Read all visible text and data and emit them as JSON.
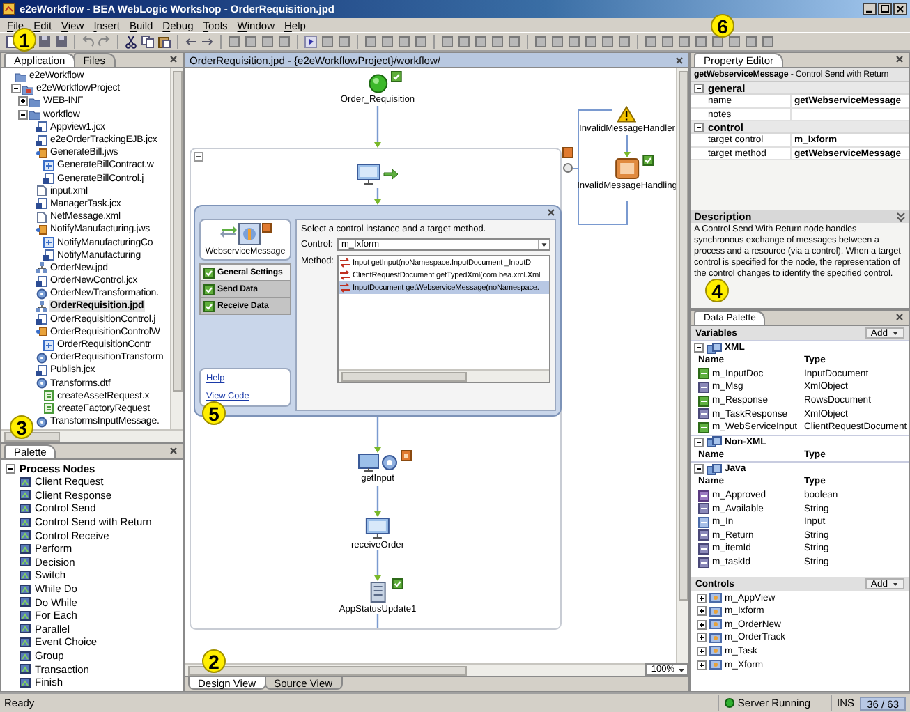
{
  "window": {
    "title": "e2eWorkflow - BEA WebLogic Workshop - OrderRequisition.jpd"
  },
  "menu": [
    "File",
    "Edit",
    "View",
    "Insert",
    "Build",
    "Debug",
    "Tools",
    "Window",
    "Help"
  ],
  "application_panel": {
    "tabs": [
      {
        "label": "Application",
        "selected": true
      },
      {
        "label": "Files",
        "selected": false
      }
    ],
    "tree": [
      {
        "label": "e2eWorkflow",
        "kind": "app",
        "selected": false,
        "children": [
          {
            "label": "e2eWorkflowProject",
            "kind": "project",
            "expanded": true,
            "selected": false,
            "children": [
              {
                "label": "WEB-INF",
                "kind": "folder",
                "expanded": false,
                "selected": false
              },
              {
                "label": "workflow",
                "kind": "folder",
                "expanded": true,
                "selected": false,
                "children": [
                  {
                    "label": "Appview1.jcx",
                    "kind": "control",
                    "selected": false
                  },
                  {
                    "label": "e2eOrderTrackingEJB.jcx",
                    "kind": "control",
                    "selected": false
                  },
                  {
                    "label": "GenerateBill.jws",
                    "kind": "service",
                    "selected": false,
                    "children": [
                      {
                        "label": "GenerateBillContract.w",
                        "kind": "wsdl",
                        "selected": false
                      },
                      {
                        "label": "GenerateBillControl.j",
                        "kind": "control",
                        "selected": false
                      }
                    ]
                  },
                  {
                    "label": "input.xml",
                    "kind": "xml",
                    "selected": false
                  },
                  {
                    "label": "ManagerTask.jcx",
                    "kind": "control",
                    "selected": false
                  },
                  {
                    "label": "NetMessage.xml",
                    "kind": "xml",
                    "selected": false
                  },
                  {
                    "label": "NotifyManufacturing.jws",
                    "kind": "service",
                    "selected": false,
                    "children": [
                      {
                        "label": "NotifyManufacturingCo",
                        "kind": "wsdl",
                        "selected": false
                      },
                      {
                        "label": "NotifyManufacturing",
                        "kind": "control",
                        "selected": false
                      }
                    ]
                  },
                  {
                    "label": "OrderNew.jpd",
                    "kind": "process",
                    "selected": false
                  },
                  {
                    "label": "OrderNewControl.jcx",
                    "kind": "control",
                    "selected": false
                  },
                  {
                    "label": "OrderNewTransformation.",
                    "kind": "transform",
                    "selected": false
                  },
                  {
                    "label": "OrderRequisition.jpd",
                    "kind": "process",
                    "selected": true
                  },
                  {
                    "label": "OrderRequisitionControl.j",
                    "kind": "control",
                    "selected": false
                  },
                  {
                    "label": "OrderRequisitionControlW",
                    "kind": "service",
                    "selected": false,
                    "children": [
                      {
                        "label": "OrderRequisitionContr",
                        "kind": "wsdl",
                        "selected": false
                      }
                    ]
                  },
                  {
                    "label": "OrderRequisitionTransform",
                    "kind": "transform",
                    "selected": false
                  },
                  {
                    "label": "Publish.jcx",
                    "kind": "control",
                    "selected": false
                  },
                  {
                    "label": "Transforms.dtf",
                    "kind": "transform",
                    "selected": false,
                    "children": [
                      {
                        "label": "createAssetRequest.x",
                        "kind": "query",
                        "selected": false
                      },
                      {
                        "label": "createFactoryRequest",
                        "kind": "query",
                        "selected": false
                      }
                    ]
                  },
                  {
                    "label": "TransformsInputMessage.",
                    "kind": "transform",
                    "selected": false
                  }
                ]
              }
            ]
          }
        ]
      }
    ]
  },
  "palette_panel": {
    "tab": "Palette",
    "section": "Process Nodes",
    "expanded": true,
    "items": [
      "Client Request",
      "Client Response",
      "Control Send",
      "Control Send with Return",
      "Control Receive",
      "Perform",
      "Decision",
      "Switch",
      "While Do",
      "Do While",
      "For Each",
      "Parallel",
      "Event Choice",
      "Group",
      "Transaction",
      "Finish"
    ]
  },
  "editor": {
    "tab": "OrderRequisition.jpd - {e2eWorkflowProject}/workflow/",
    "nodes": [
      {
        "kind": "start",
        "label": "Order_Requisition"
      },
      {
        "kind": "client"
      },
      {
        "kind": "control_send",
        "label": "getInput"
      },
      {
        "kind": "client_receive",
        "label": "receiveOrder"
      },
      {
        "kind": "control_receive",
        "label": "AppStatusUpdate1"
      },
      {
        "kind": "warning",
        "label": "InvalidMessageHandler"
      },
      {
        "kind": "perform",
        "label": "InvalidMessageHandling"
      }
    ],
    "dialog": {
      "node_label": "WebserviceMessage",
      "tabs": [
        {
          "label": "General Settings",
          "selected": true,
          "checked": true
        },
        {
          "label": "Send Data",
          "selected": false,
          "checked": true
        },
        {
          "label": "Receive Data",
          "selected": false,
          "checked": true
        }
      ],
      "links": [
        "Help",
        "View Code"
      ],
      "instruction": "Select a control instance and a target method.",
      "control_label": "Control:",
      "control_value": "m_Ixform",
      "method_label": "Method:",
      "methods": [
        {
          "text": "Input getInput(noNamespace.InputDocument _InputD",
          "selected": false
        },
        {
          "text": "ClientRequestDocument getTypedXml(com.bea.xml.Xml",
          "selected": false
        },
        {
          "text": "InputDocument getWebserviceMessage(noNamespace.",
          "selected": true
        }
      ]
    },
    "zoom": "100%",
    "view_tabs": [
      {
        "label": "Design View",
        "selected": true
      },
      {
        "label": "Source View",
        "selected": false
      }
    ]
  },
  "property_editor": {
    "tab": "Property Editor",
    "header": "**getWebserviceMessage** - Control Send with Return",
    "sections": [
      {
        "title": "general",
        "expanded": true,
        "rows": [
          {
            "name": "name",
            "value": "getWebserviceMessage"
          },
          {
            "name": "notes"
          }
        ]
      },
      {
        "title": "control",
        "expanded": true,
        "rows": [
          {
            "name": "target control",
            "value": "m_Ixform"
          },
          {
            "name": "target method",
            "value": "getWebserviceMessage"
          }
        ]
      }
    ],
    "description_title": "Description",
    "description": "A Control Send With Return node handles synchronous exchange of messages between a process and a resource (via a control). When a target control is specified for the node, the representation of the control changes to identify the specified control."
  },
  "data_palette": {
    "tab": "Data Palette",
    "variables_title": "Variables",
    "add": "Add",
    "groups": [
      {
        "title": "XML",
        "expanded": true,
        "columns": [
          "Name",
          "Type"
        ],
        "rows": [
          {
            "name": "m_InputDoc",
            "type": "InputDocument",
            "kind": "xml"
          },
          {
            "name": "m_Msg",
            "type": "XmlObject",
            "kind": "object"
          },
          {
            "name": "m_Response",
            "type": "RowsDocument",
            "kind": "xml"
          },
          {
            "name": "m_TaskResponse",
            "type": "XmlObject",
            "kind": "object"
          },
          {
            "name": "m_WebServiceInput",
            "type": "ClientRequestDocument",
            "kind": "xml"
          }
        ]
      },
      {
        "title": "Non-XML",
        "expanded": true,
        "columns": [
          "Name",
          "Type"
        ]
      },
      {
        "title": "Java",
        "expanded": true,
        "columns": [
          "Name",
          "Type"
        ],
        "rows": [
          {
            "name": "m_Approved",
            "type": "boolean",
            "kind": "boolean"
          },
          {
            "name": "m_Available",
            "type": "String",
            "kind": "string"
          },
          {
            "name": "m_In",
            "type": "Input",
            "kind": "input"
          },
          {
            "name": "m_Return",
            "type": "String",
            "kind": "string"
          },
          {
            "name": "m_itemId",
            "type": "String",
            "kind": "string"
          },
          {
            "name": "m_taskId",
            "type": "String",
            "kind": "string"
          }
        ]
      }
    ],
    "controls_title": "Controls",
    "controls_add": "Add",
    "controls": [
      {
        "label": "m_AppView",
        "expanded": false
      },
      {
        "label": "m_Ixform",
        "expanded": false
      },
      {
        "label": "m_OrderNew",
        "expanded": false
      },
      {
        "label": "m_OrderTrack",
        "expanded": false
      },
      {
        "label": "m_Task",
        "expanded": false
      },
      {
        "label": "m_Xform",
        "expanded": false
      }
    ]
  },
  "status_bar": {
    "message": "Ready",
    "server": "Server Running",
    "mode": "INS",
    "position": "36 / 63"
  },
  "callouts": [
    {
      "text": "1"
    },
    {
      "text": "2"
    },
    {
      "text": "3"
    },
    {
      "text": "4"
    },
    {
      "text": "5"
    },
    {
      "text": "6"
    }
  ]
}
